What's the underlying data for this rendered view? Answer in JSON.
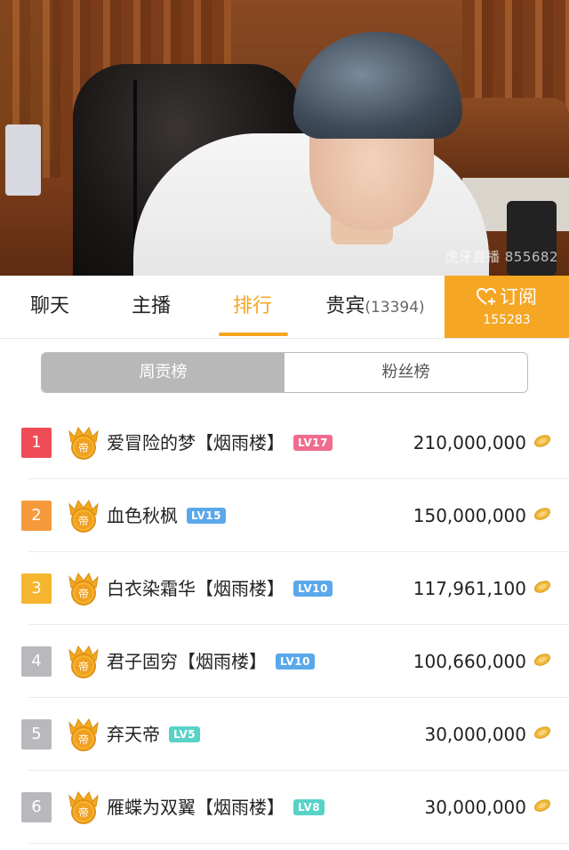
{
  "stream": {
    "watermark": "虎牙直播 855682"
  },
  "tabs": [
    {
      "label": "聊天",
      "count": ""
    },
    {
      "label": "主播",
      "count": ""
    },
    {
      "label": "排行",
      "count": ""
    },
    {
      "label": "贵宾",
      "count": "(13394)"
    }
  ],
  "active_tab": "排行",
  "subscribe": {
    "label": "订阅",
    "count": "155283"
  },
  "segment": {
    "active": "周贡榜",
    "other": "粉丝榜"
  },
  "badge_char": "帝",
  "ranking": [
    {
      "rank": "1",
      "name": "爱冒险的梦【烟雨楼】",
      "level": "LV17",
      "amount": "210,000,000",
      "rank_color": "#ee4d57",
      "level_color": "#f06b8e"
    },
    {
      "rank": "2",
      "name": "血色秋枫",
      "level": "LV15",
      "amount": "150,000,000",
      "rank_color": "#f59a3c",
      "level_color": "#5aa8ea"
    },
    {
      "rank": "3",
      "name": "白衣染霜华【烟雨楼】",
      "level": "LV10",
      "amount": "117,961,100",
      "rank_color": "#f5b52e",
      "level_color": "#5aa8ea"
    },
    {
      "rank": "4",
      "name": "君子固穷【烟雨楼】",
      "level": "LV10",
      "amount": "100,660,000",
      "rank_color": "#b9b9bd",
      "level_color": "#5aa8ea"
    },
    {
      "rank": "5",
      "name": "弃天帝",
      "level": "LV5",
      "amount": "30,000,000",
      "rank_color": "#b9b9bd",
      "level_color": "#58d2c7"
    },
    {
      "rank": "6",
      "name": "雁蝶为双翼【烟雨楼】",
      "level": "LV8",
      "amount": "30,000,000",
      "rank_color": "#b9b9bd",
      "level_color": "#58d2c7"
    }
  ],
  "colors": {
    "accent": "#f5a623",
    "coin": "#f2b83a"
  }
}
